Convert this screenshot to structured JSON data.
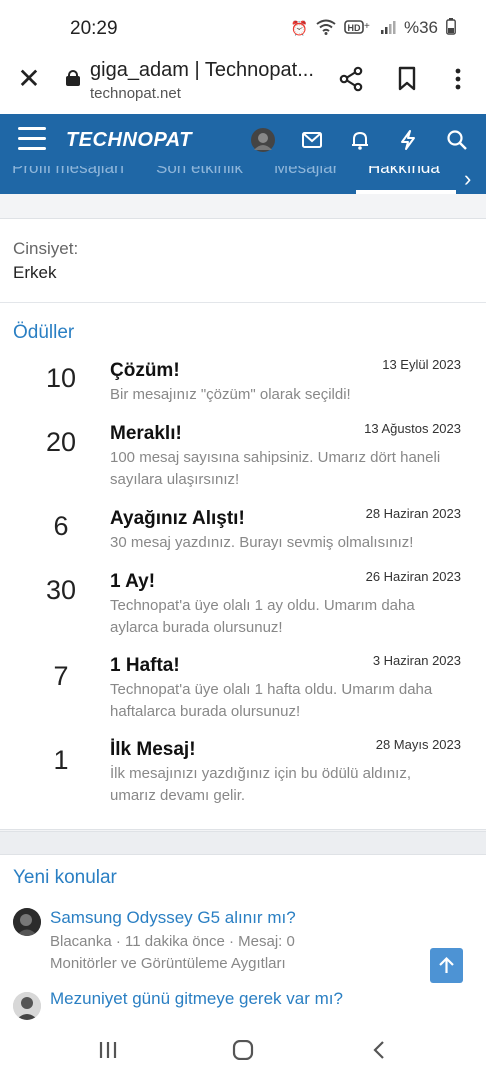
{
  "status": {
    "time": "20:29",
    "battery": "%36"
  },
  "browser": {
    "title": "giga_adam | Technopat...",
    "url": "technopat.net"
  },
  "site": {
    "logo": "TECHNOPAT",
    "tabs": [
      "Profil mesajları",
      "Son etkinlik",
      "Mesajlar",
      "Hakkında"
    ],
    "active_tab": "Hakkında"
  },
  "profile": {
    "gender_label": "Cinsiyet:",
    "gender_value": "Erkek"
  },
  "awards": {
    "heading": "Ödüller",
    "items": [
      {
        "count": "10",
        "title": "Çözüm!",
        "date": "13 Eylül 2023",
        "desc": "Bir mesajınız \"çözüm\" olarak seçildi!"
      },
      {
        "count": "20",
        "title": "Meraklı!",
        "date": "13 Ağustos 2023",
        "desc": "100 mesaj sayısına sahipsiniz. Umarız dört haneli sayılara ulaşırsınız!"
      },
      {
        "count": "6",
        "title": "Ayağınız Alıştı!",
        "date": "28 Haziran 2023",
        "desc": "30 mesaj yazdınız. Burayı sevmiş olmalısınız!"
      },
      {
        "count": "30",
        "title": "1 Ay!",
        "date": "26 Haziran 2023",
        "desc": "Technopat'a üye olalı 1 ay oldu. Umarım daha aylarca burada olursunuz!"
      },
      {
        "count": "7",
        "title": "1 Hafta!",
        "date": "3 Haziran 2023",
        "desc": "Technopat'a üye olalı 1 hafta oldu. Umarım daha haftalarca burada olursunuz!"
      },
      {
        "count": "1",
        "title": "İlk Mesaj!",
        "date": "28 Mayıs 2023",
        "desc": "İlk mesajınızı yazdığınız için bu ödülü aldınız, umarız devamı gelir."
      }
    ]
  },
  "new_topics": {
    "heading": "Yeni konular",
    "items": [
      {
        "title": "Samsung Odyssey G5 alınır mı?",
        "meta": "Blacanka · 11 dakika önce · Mesaj: 0",
        "forum": "Monitörler ve Görüntüleme Aygıtları"
      },
      {
        "title": "Mezuniyet günü gitmeye gerek var mı?",
        "meta": "",
        "forum": ""
      }
    ]
  },
  "colors": {
    "brand": "#1f67a6",
    "link": "#2a7fc3"
  }
}
